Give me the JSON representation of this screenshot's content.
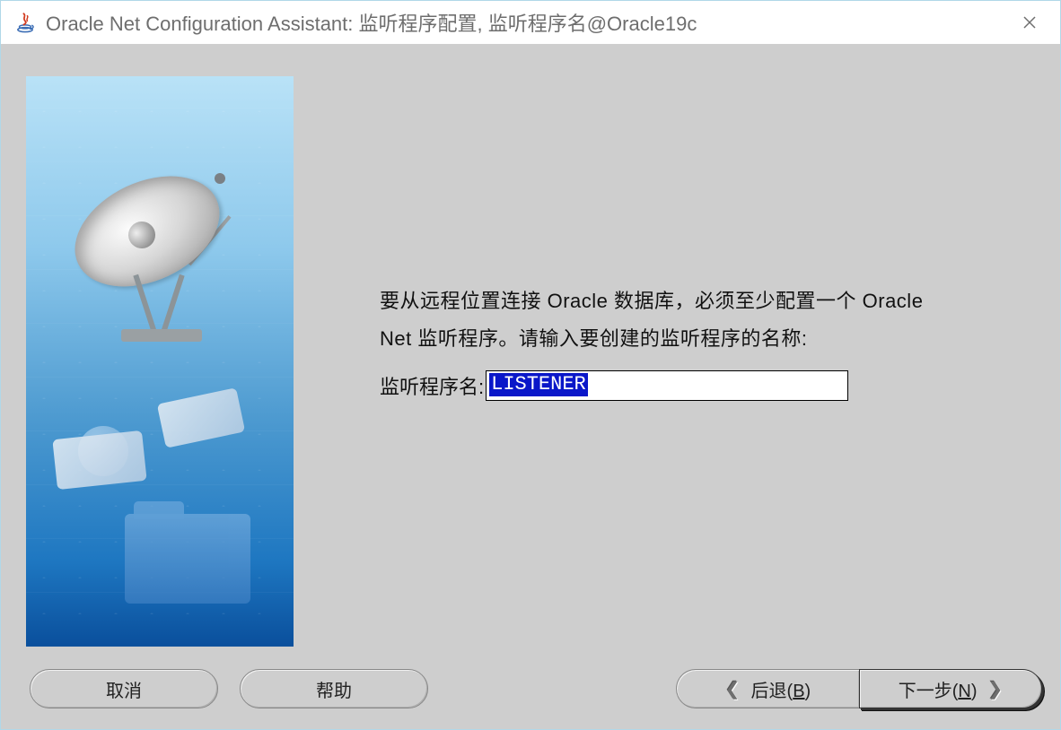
{
  "titlebar": {
    "title": "Oracle Net Configuration Assistant: 监听程序配置, 监听程序名@Oracle19c"
  },
  "main": {
    "description": "要从远程位置连接 Oracle 数据库，必须至少配置一个 Oracle Net 监听程序。请输入要创建的监听程序的名称:",
    "listener_label": "监听程序名:",
    "listener_value": "LISTENER"
  },
  "buttons": {
    "cancel": "取消",
    "help": "帮助",
    "back_prefix": "后退(",
    "back_mnemonic": "B",
    "back_suffix": ")",
    "next_prefix": "下一步(",
    "next_mnemonic": "N",
    "next_suffix": ")"
  }
}
